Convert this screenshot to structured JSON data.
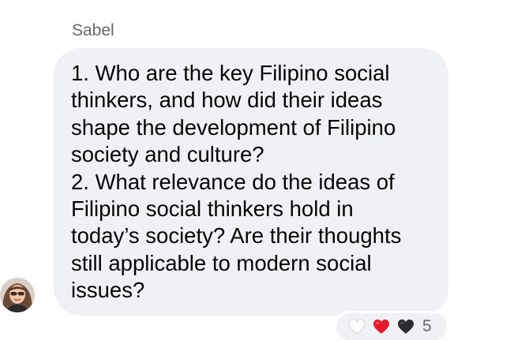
{
  "message": {
    "sender_name": "Sabel",
    "text_lines": [
      "1. Who are the key Filipino social",
      "thinkers, and how did their ideas",
      "shape the development of Filipino",
      "society and culture?",
      "2. What relevance do the ideas of",
      "Filipino social thinkers hold in",
      "today’s society? Are their thoughts",
      "still applicable to modern social",
      "issues?"
    ]
  },
  "reactions": {
    "icons": [
      "white-heart-icon",
      "red-heart-icon",
      "black-heart-icon"
    ],
    "count": "5"
  },
  "colors": {
    "bubble_background": "#f0f1f5",
    "text": "#050505",
    "secondary_text": "#65676b",
    "red_heart": "#e8192c",
    "black_heart": "#2b2d31"
  }
}
